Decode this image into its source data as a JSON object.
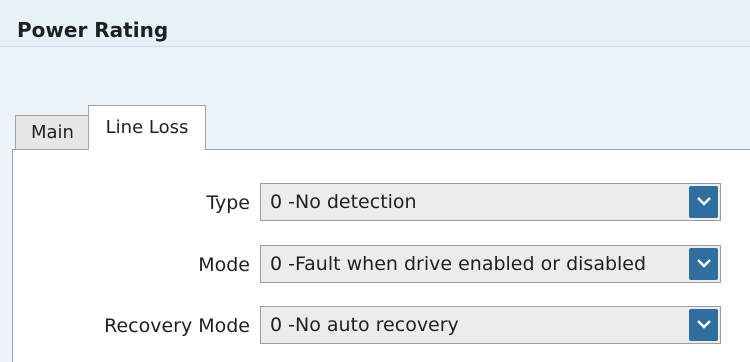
{
  "header": {
    "title": "Power Rating"
  },
  "tabs": [
    {
      "label": "Main",
      "selected": false
    },
    {
      "label": "Line Loss",
      "selected": true
    }
  ],
  "fields": [
    {
      "label": "Type",
      "value": "0  -No detection"
    },
    {
      "label": "Mode",
      "value": "0  -Fault when drive enabled or disabled"
    },
    {
      "label": "Recovery Mode",
      "value": "0  -No auto recovery"
    }
  ],
  "icons": {
    "dropdown": "chevron-down-icon"
  },
  "colors": {
    "header_bg": "#e6f2f8",
    "dropdown_button": "#2f6f9f",
    "combo_bg": "#ececec"
  }
}
